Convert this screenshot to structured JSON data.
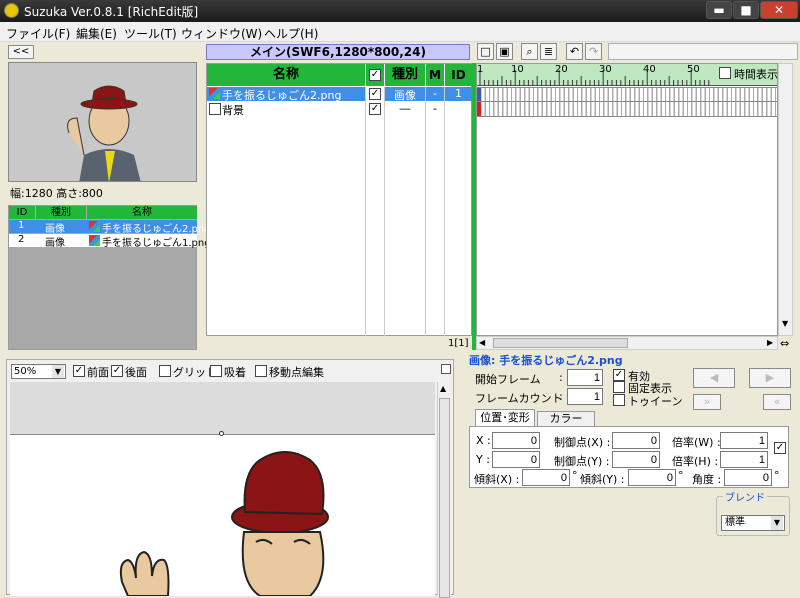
{
  "window": {
    "title": "Suzuka Ver.0.8.1 [RichEdit版]",
    "minimize": "▬",
    "maximize": "■",
    "close": "✕"
  },
  "menu": [
    "ファイル(F)",
    "編集(E)",
    "ツール(T)",
    "ウィンドウ(W)",
    "ヘルプ(H)"
  ],
  "left": {
    "collapse": "<<",
    "size_info": "幅:1280 高さ:800",
    "lib_headers": [
      "ID",
      "種別",
      "名称"
    ],
    "lib_rows": [
      {
        "id": "1",
        "type": "画像",
        "name": "手を振るじゅごん2.png"
      },
      {
        "id": "2",
        "type": "画像",
        "name": "手を振るじゅごん1.png"
      }
    ]
  },
  "scene": {
    "title": "メイン(SWF6,1280*800,24)",
    "headers": [
      "名称",
      "種別",
      "M",
      "ID"
    ],
    "rows": [
      {
        "name": "手を振るじゅごん2.png",
        "type": "画像",
        "m": "-",
        "id": "1"
      },
      {
        "name": "背景",
        "type": "―",
        "m": "-",
        "id": ""
      }
    ],
    "page_indicator": "1[1]"
  },
  "timeline": {
    "ticks": [
      "1",
      "10",
      "20",
      "30",
      "40",
      "50"
    ],
    "time_display": "時間表示"
  },
  "stage": {
    "zoom": "50%",
    "front": "前面",
    "back": "後面",
    "grid": "グリッド",
    "snap": "吸着",
    "edit_points": "移動点編集"
  },
  "props": {
    "heading": "画像: 手を振るじゅごん2.png",
    "start_frame_label": "開始フレーム",
    "start_frame": "1",
    "frame_count_label": "フレームカウント",
    "frame_count": "1",
    "enabled": "有効",
    "fixed": "固定表示",
    "tween": "トゥイーン",
    "tab_transform": "位置･変形",
    "tab_color": "カラー",
    "x_label": "X :",
    "x": "0",
    "y_label": "Y :",
    "y": "0",
    "cx_label": "制御点(X) :",
    "cx": "0",
    "cy_label": "制御点(Y) :",
    "cy": "0",
    "sw_label": "倍率(W) :",
    "sw": "1",
    "sh_label": "倍率(H) :",
    "sh": "1",
    "skx_label": "傾斜(X) :",
    "skx": "0",
    "sky_label": "傾斜(Y) :",
    "sky": "0",
    "angle_label": "角度 :",
    "angle": "0",
    "deg": "°",
    "blend_label": "ブレンド",
    "blend": "標準",
    "prev": "◀",
    "next": "▶",
    "ff": "»",
    "rw": "«"
  },
  "colors": {
    "green": "#22b73a",
    "select": "#3f8ee8",
    "hat": "#8b1414"
  }
}
